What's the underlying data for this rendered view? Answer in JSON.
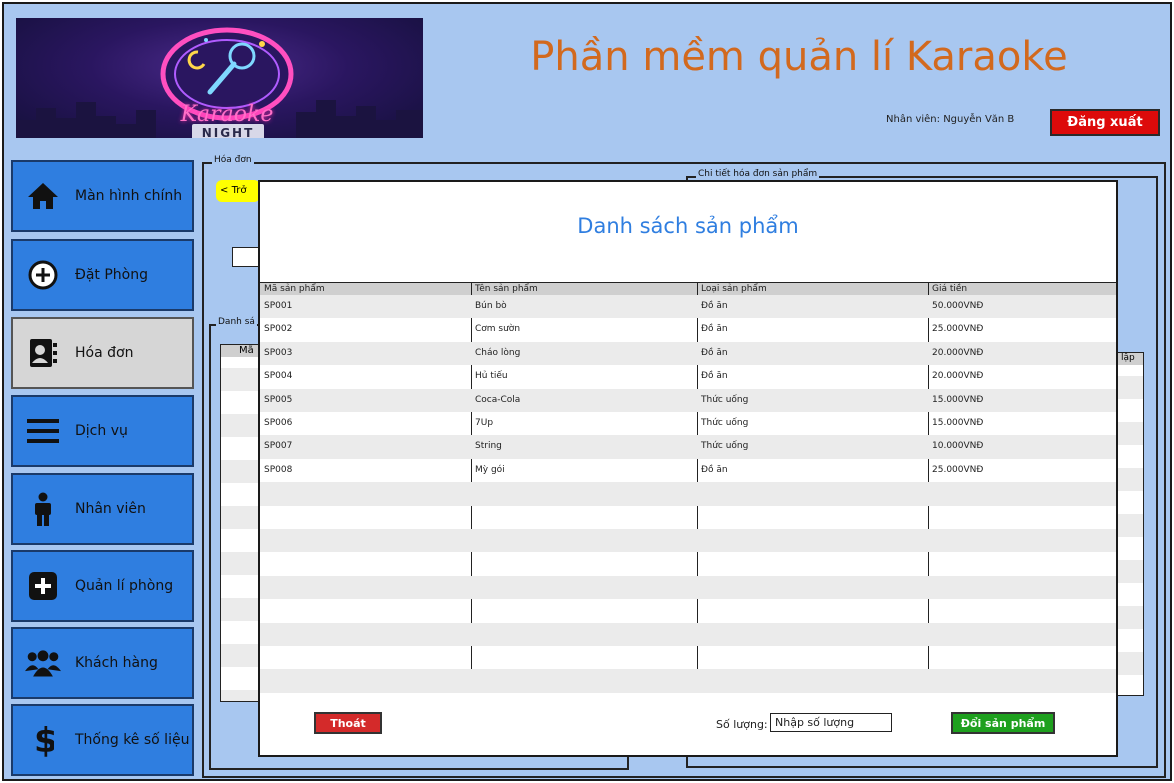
{
  "header": {
    "title": "Phần mềm quản lí Karaoke",
    "employee": "Nhân viên: Nguyễn Văn B",
    "logout_label": "Đăng xuất",
    "logo_script": "Karaoke",
    "logo_night": "NIGHT"
  },
  "sidebar": {
    "items": [
      {
        "label": "Màn hình chính",
        "icon": "home-icon"
      },
      {
        "label": "Đặt Phòng",
        "icon": "plus-circle-icon"
      },
      {
        "label": "Hóa đơn",
        "icon": "contact-card-icon"
      },
      {
        "label": "Dịch vụ",
        "icon": "menu-icon"
      },
      {
        "label": "Nhân viên",
        "icon": "person-icon"
      },
      {
        "label": "Quản lí phòng",
        "icon": "plus-square-icon"
      },
      {
        "label": "Khách hàng",
        "icon": "group-icon"
      },
      {
        "label": "Thống kê số liệu",
        "icon": "dollar-icon"
      }
    ],
    "active_index": 2
  },
  "background": {
    "invoice_group": "Hóa đơn",
    "detail_group": "Chi tiết hóa đơn sản phẩm",
    "back_label": "Trở",
    "list_group": "Danh sá",
    "partial_col": "Mã",
    "partial_right": "lập"
  },
  "modal": {
    "title": "Danh sách sản phẩm",
    "columns": [
      "Mã sản phẩm",
      "Tên sản phẩm",
      "Loại sản phẩm",
      "Giá tiền"
    ],
    "rows": [
      [
        "SP001",
        "Bún bò",
        "Đồ ăn",
        "50.000VNĐ"
      ],
      [
        "SP002",
        "Cơm sườn",
        "Đồ ăn",
        "25.000VNĐ"
      ],
      [
        "SP003",
        "Cháo lòng",
        "Đồ ăn",
        "20.000VNĐ"
      ],
      [
        "SP004",
        "Hủ tiếu",
        "Đồ ăn",
        "20.000VNĐ"
      ],
      [
        "SP005",
        "Coca-Cola",
        "Thức uống",
        "15.000VNĐ"
      ],
      [
        "SP006",
        "7Up",
        "Thức uống",
        "15.000VNĐ"
      ],
      [
        "SP007",
        "String",
        "Thức uống",
        "10.000VNĐ"
      ],
      [
        "SP008",
        "Mỳ gói",
        "Đồ ăn",
        "25.000VNĐ"
      ]
    ],
    "exit_label": "Thoát",
    "qty_label": "Số lượng:",
    "qty_placeholder": "Nhập số lượng",
    "change_label": "Đổi sản phẩm"
  },
  "colors": {
    "title": "#d2691e",
    "nav": "#2f7ee0",
    "background": "#a8c7f0",
    "logout": "#dd0a0a",
    "exit": "#d42a2a",
    "change": "#1ea01e"
  }
}
